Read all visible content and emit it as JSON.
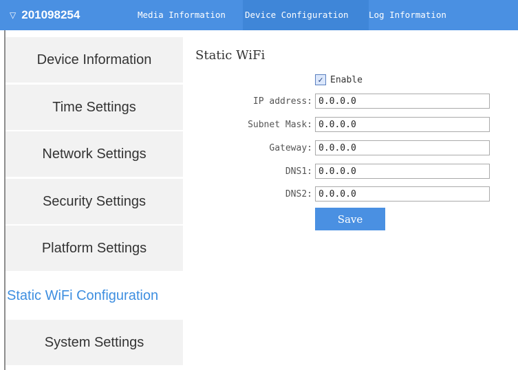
{
  "header": {
    "device_id": "201098254",
    "menu": [
      {
        "label": "Media Information"
      },
      {
        "label": "Device Configuration"
      },
      {
        "label": "Log Information"
      }
    ]
  },
  "sidebar": {
    "items": [
      {
        "label": "Device Information"
      },
      {
        "label": "Time Settings"
      },
      {
        "label": "Network Settings"
      },
      {
        "label": "Security Settings"
      },
      {
        "label": "Platform Settings"
      },
      {
        "label": "Static WiFi Configuration",
        "active": true
      },
      {
        "label": "System Settings"
      }
    ]
  },
  "form": {
    "title": "Static WiFi",
    "enable_label": "Enable",
    "enable_checked": true,
    "fields": [
      {
        "label": "IP address:",
        "value": "0.0.0.0"
      },
      {
        "label": "Subnet Mask:",
        "value": "0.0.0.0"
      },
      {
        "label": "Gateway:",
        "value": "0.0.0.0"
      },
      {
        "label": "DNS1:",
        "value": "0.0.0.0"
      },
      {
        "label": "DNS2:",
        "value": "0.0.0.0"
      }
    ],
    "save_label": "Save"
  },
  "colors": {
    "accent": "#4a90e2",
    "active_text": "#3d8ee0",
    "sidebar_bg": "#f2f2f2"
  }
}
